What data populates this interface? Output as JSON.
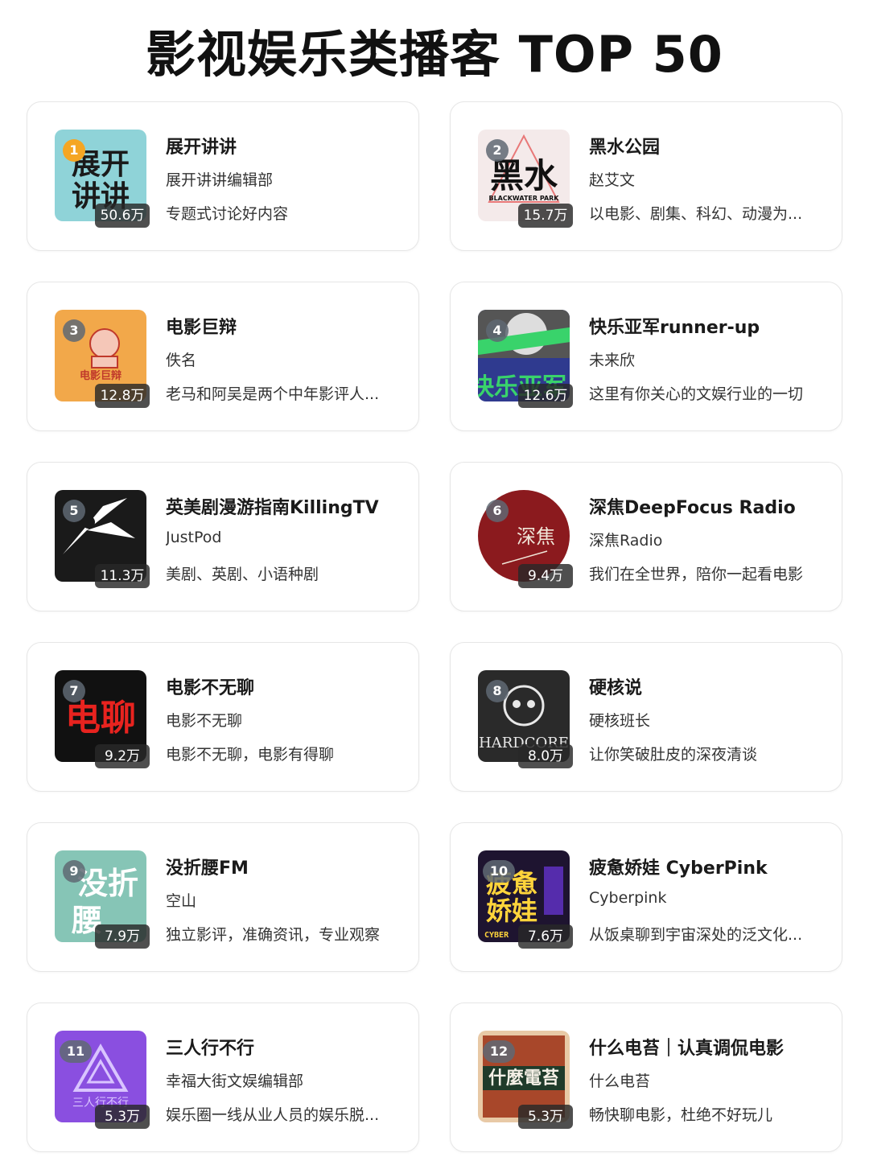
{
  "page": {
    "title": "影视娱乐类播客 TOP 50"
  },
  "podcasts": [
    {
      "rank": "1",
      "name": "展开讲讲",
      "author": "展开讲讲编辑部",
      "desc": "专题式讨论好内容",
      "plays": "50.6万",
      "cover_text": "展开讲讲",
      "cover_bg": "#8fd3d8",
      "cover_fg": "#1a1a1a"
    },
    {
      "rank": "2",
      "name": "黑水公园",
      "author": "赵艾文",
      "desc": "以电影、剧集、科幻、动漫为...",
      "plays": "15.7万",
      "cover_text": "黑水",
      "cover_sub": "BLACKWATER PARK",
      "cover_bg": "#f4eaea",
      "cover_fg": "#111111"
    },
    {
      "rank": "3",
      "name": "电影巨辩",
      "author": "佚名",
      "desc": "老马和阿吴是两个中年影评人...",
      "plays": "12.8万",
      "cover_text": "电影巨辩",
      "cover_bg": "#f2a84a",
      "cover_fg": "#c0392b"
    },
    {
      "rank": "4",
      "name": "快乐亚军runner-up",
      "author": "未来欣",
      "desc": "这里有你关心的文娱行业的一切",
      "plays": "12.6万",
      "cover_text": "快乐亚军",
      "cover_bg": "#2f3a8f",
      "cover_fg": "#39d36b"
    },
    {
      "rank": "5",
      "name": "英美剧漫游指南KillingTV",
      "author": "JustPod",
      "desc": "美剧、英剧、小语种剧",
      "plays": "11.3万",
      "cover_bg": "#1a1a1a",
      "cover_fg": "#ffffff"
    },
    {
      "rank": "6",
      "name": "深焦DeepFocus Radio",
      "author": "深焦Radio",
      "desc": "我们在全世界，陪你一起看电影",
      "plays": "9.4万",
      "cover_text": "深焦",
      "cover_bg": "#8b1a1e",
      "cover_fg": "#f0e6d8"
    },
    {
      "rank": "7",
      "name": "电影不无聊",
      "author": "电影不无聊",
      "desc": "电影不无聊，电影有得聊",
      "plays": "9.2万",
      "cover_text": "电聊",
      "cover_bg": "#111111",
      "cover_fg": "#e8231f"
    },
    {
      "rank": "8",
      "name": "硬核说",
      "author": "硬核班长",
      "desc": "让你笑破肚皮的深夜清谈",
      "plays": "8.0万",
      "cover_text": "HARDCORE",
      "cover_bg": "#2a2a2a",
      "cover_fg": "#e8e8e8"
    },
    {
      "rank": "9",
      "name": "没折腰FM",
      "author": "空山",
      "desc": "独立影评，准确资讯，专业观察",
      "plays": "7.9万",
      "cover_text": "没折腰",
      "cover_bg": "#86c5b6",
      "cover_fg": "#ffffff"
    },
    {
      "rank": "10",
      "name": "疲惫娇娃 CyberPink",
      "author": "Cyberpink",
      "desc": "从饭桌聊到宇宙深处的泛文化...",
      "plays": "7.6万",
      "cover_text": "疲惫娇娃",
      "cover_sub": "CYBER",
      "cover_bg": "#1e1430",
      "cover_fg": "#ffd43b"
    },
    {
      "rank": "11",
      "name": "三人行不行",
      "author": "幸福大街文娱编辑部",
      "desc": "娱乐圈一线从业人员的娱乐脱...",
      "plays": "5.3万",
      "cover_text": "三人行不行",
      "cover_bg": "#8a4fe0",
      "cover_fg": "#d9c4ff"
    },
    {
      "rank": "12",
      "name": "什么电苔｜认真调侃电影",
      "author": "什么电苔",
      "desc": "畅快聊电影，杜绝不好玩儿",
      "plays": "5.3万",
      "cover_text": "什麼電苔",
      "cover_bg": "#e8c9a6",
      "cover_fg": "#f5f0e6"
    }
  ]
}
